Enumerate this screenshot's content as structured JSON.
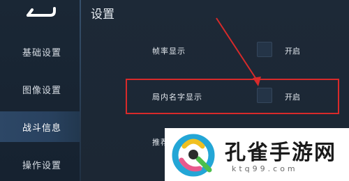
{
  "sidebar": {
    "items": [
      {
        "label": "基础设置"
      },
      {
        "label": "图像设置"
      },
      {
        "label": "战斗信息",
        "active": true
      },
      {
        "label": "操作设置"
      }
    ]
  },
  "main": {
    "title": "设置",
    "rows": [
      {
        "label": "帧率显示",
        "value_label": "开启",
        "checked": false
      },
      {
        "label": "局内名字显示",
        "value_label": "开启",
        "checked": false
      },
      {
        "label": "推荐",
        "partially_hidden": true
      }
    ]
  },
  "watermark": {
    "title": "孔雀手游网",
    "url": "ktq99.com"
  },
  "colors": {
    "highlight": "#d82a2a",
    "arrow": "#d82a2a",
    "active_tab": "#2d4766",
    "background": "#1b2634"
  }
}
